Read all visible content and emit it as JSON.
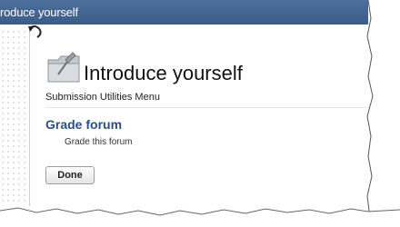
{
  "window": {
    "title": "roduce yourself"
  },
  "page": {
    "heading": "Introduce yourself",
    "subheading": "Submission Utilities Menu"
  },
  "utilities": [
    {
      "label": "Grade forum",
      "description": "Grade this forum"
    }
  ],
  "actions": {
    "done_label": "Done"
  },
  "icons": {
    "back": "back-arrow-icon",
    "module": "folder-pushpin-icon"
  },
  "colors": {
    "titlebar": "#3f6190",
    "link": "#2a4f84"
  }
}
